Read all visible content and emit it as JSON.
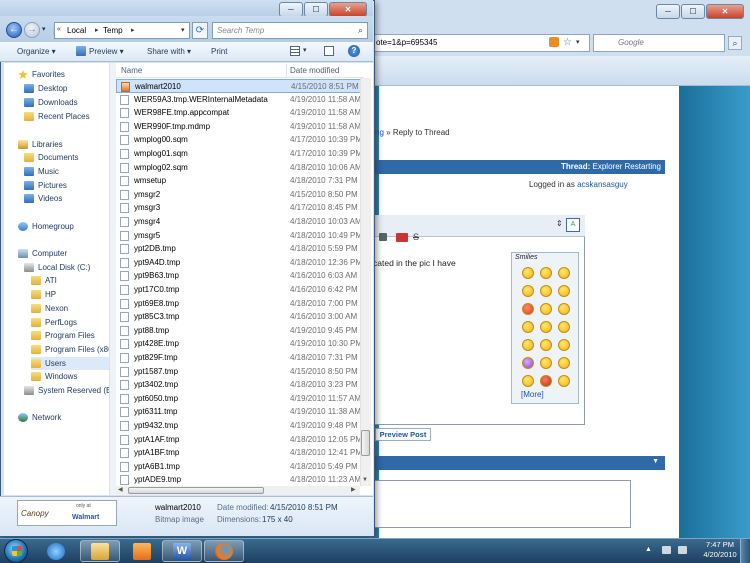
{
  "browser": {
    "address_text": "ote=1&p=695345",
    "search_placeholder": "Google",
    "breadcrumb_prev": "ting",
    "breadcrumb_current": "» Reply to Thread",
    "thread_label": "Thread:",
    "thread_title": "Explorer Restarting",
    "logged_in_text": "Logged in as",
    "logged_in_user": "acskansasguy",
    "editor_text": "cated in the pic I have",
    "smilies_title": "Smilies",
    "more_link": "[More]",
    "preview_button": "Preview Post"
  },
  "explorer": {
    "breadcrumb": [
      "Local",
      "Temp"
    ],
    "search_placeholder": "Search Temp",
    "toolbar": {
      "organize": "Organize ▾",
      "preview": "Preview ▾",
      "share_with": "Share with ▾",
      "print": "Print"
    },
    "nav": {
      "favorites": "Favorites",
      "desktop": "Desktop",
      "downloads": "Downloads",
      "recent_places": "Recent Places",
      "libraries": "Libraries",
      "documents": "Documents",
      "music": "Music",
      "pictures": "Pictures",
      "videos": "Videos",
      "homegroup": "Homegroup",
      "computer": "Computer",
      "local_disk": "Local Disk (C:)",
      "ati": "ATI",
      "hp": "HP",
      "nexon": "Nexon",
      "perflogs": "PerfLogs",
      "program_files": "Program Files",
      "program_files_x86": "Program Files (x86",
      "users": "Users",
      "windows": "Windows",
      "system_reserved": "System Reserved (E:)",
      "network": "Network"
    },
    "columns": {
      "name": "Name",
      "date_modified": "Date modified"
    },
    "files": [
      {
        "name": "walmart2010",
        "date": "4/15/2010 8:51 PM"
      },
      {
        "name": "WER59A3.tmp.WERInternalMetadata",
        "date": "4/19/2010 11:58 AM"
      },
      {
        "name": "WER98FE.tmp.appcompat",
        "date": "4/19/2010 11:58 AM"
      },
      {
        "name": "WER990F.tmp.mdmp",
        "date": "4/19/2010 11:58 AM"
      },
      {
        "name": "wmplog00.sqm",
        "date": "4/17/2010 10:39 PM"
      },
      {
        "name": "wmplog01.sqm",
        "date": "4/17/2010 10:39 PM"
      },
      {
        "name": "wmplog02.sqm",
        "date": "4/18/2010 10:06 AM"
      },
      {
        "name": "wmsetup",
        "date": "4/18/2010 7:31 PM"
      },
      {
        "name": "ymsgr2",
        "date": "4/15/2010 8:50 PM"
      },
      {
        "name": "ymsgr3",
        "date": "4/17/2010 8:45 PM"
      },
      {
        "name": "ymsgr4",
        "date": "4/18/2010 10:03 AM"
      },
      {
        "name": "ymsgr5",
        "date": "4/18/2010 10:49 PM"
      },
      {
        "name": "ypt2DB.tmp",
        "date": "4/18/2010 5:59 PM"
      },
      {
        "name": "ypt9A4D.tmp",
        "date": "4/18/2010 12:36 PM"
      },
      {
        "name": "ypt9B63.tmp",
        "date": "4/16/2010 6:03 AM"
      },
      {
        "name": "ypt17C0.tmp",
        "date": "4/16/2010 6:42 PM"
      },
      {
        "name": "ypt69E8.tmp",
        "date": "4/18/2010 7:00 PM"
      },
      {
        "name": "ypt85C3.tmp",
        "date": "4/16/2010 3:00 AM"
      },
      {
        "name": "ypt88.tmp",
        "date": "4/19/2010 9:45 PM"
      },
      {
        "name": "ypt428E.tmp",
        "date": "4/19/2010 10:30 PM"
      },
      {
        "name": "ypt829F.tmp",
        "date": "4/18/2010 7:31 PM"
      },
      {
        "name": "ypt1587.tmp",
        "date": "4/15/2010 8:50 PM"
      },
      {
        "name": "ypt3402.tmp",
        "date": "4/18/2010 3:23 PM"
      },
      {
        "name": "ypt6050.tmp",
        "date": "4/19/2010 11:57 AM"
      },
      {
        "name": "ypt6311.tmp",
        "date": "4/19/2010 11:38 AM"
      },
      {
        "name": "ypt9432.tmp",
        "date": "4/19/2010 9:48 PM"
      },
      {
        "name": "yptA1AF.tmp",
        "date": "4/18/2010 12:05 PM"
      },
      {
        "name": "yptA1BF.tmp",
        "date": "4/18/2010 12:41 PM"
      },
      {
        "name": "yptA6B1.tmp",
        "date": "4/18/2010 5:49 PM"
      },
      {
        "name": "yptADE9.tmp",
        "date": "4/18/2010 11:23 AM"
      }
    ],
    "details": {
      "thumb_canopy": "Canopy",
      "thumb_brand": "Walmart",
      "thumb_small": "only at",
      "filename": "walmart2010",
      "date_label": "Date modified:",
      "date_value": "4/15/2010 8:51 PM",
      "type": "Bitmap image",
      "dim_label": "Dimensions:",
      "dim_value": "175 x 40"
    }
  },
  "taskbar": {
    "time": "7:47 PM",
    "date": "4/20/2010"
  }
}
